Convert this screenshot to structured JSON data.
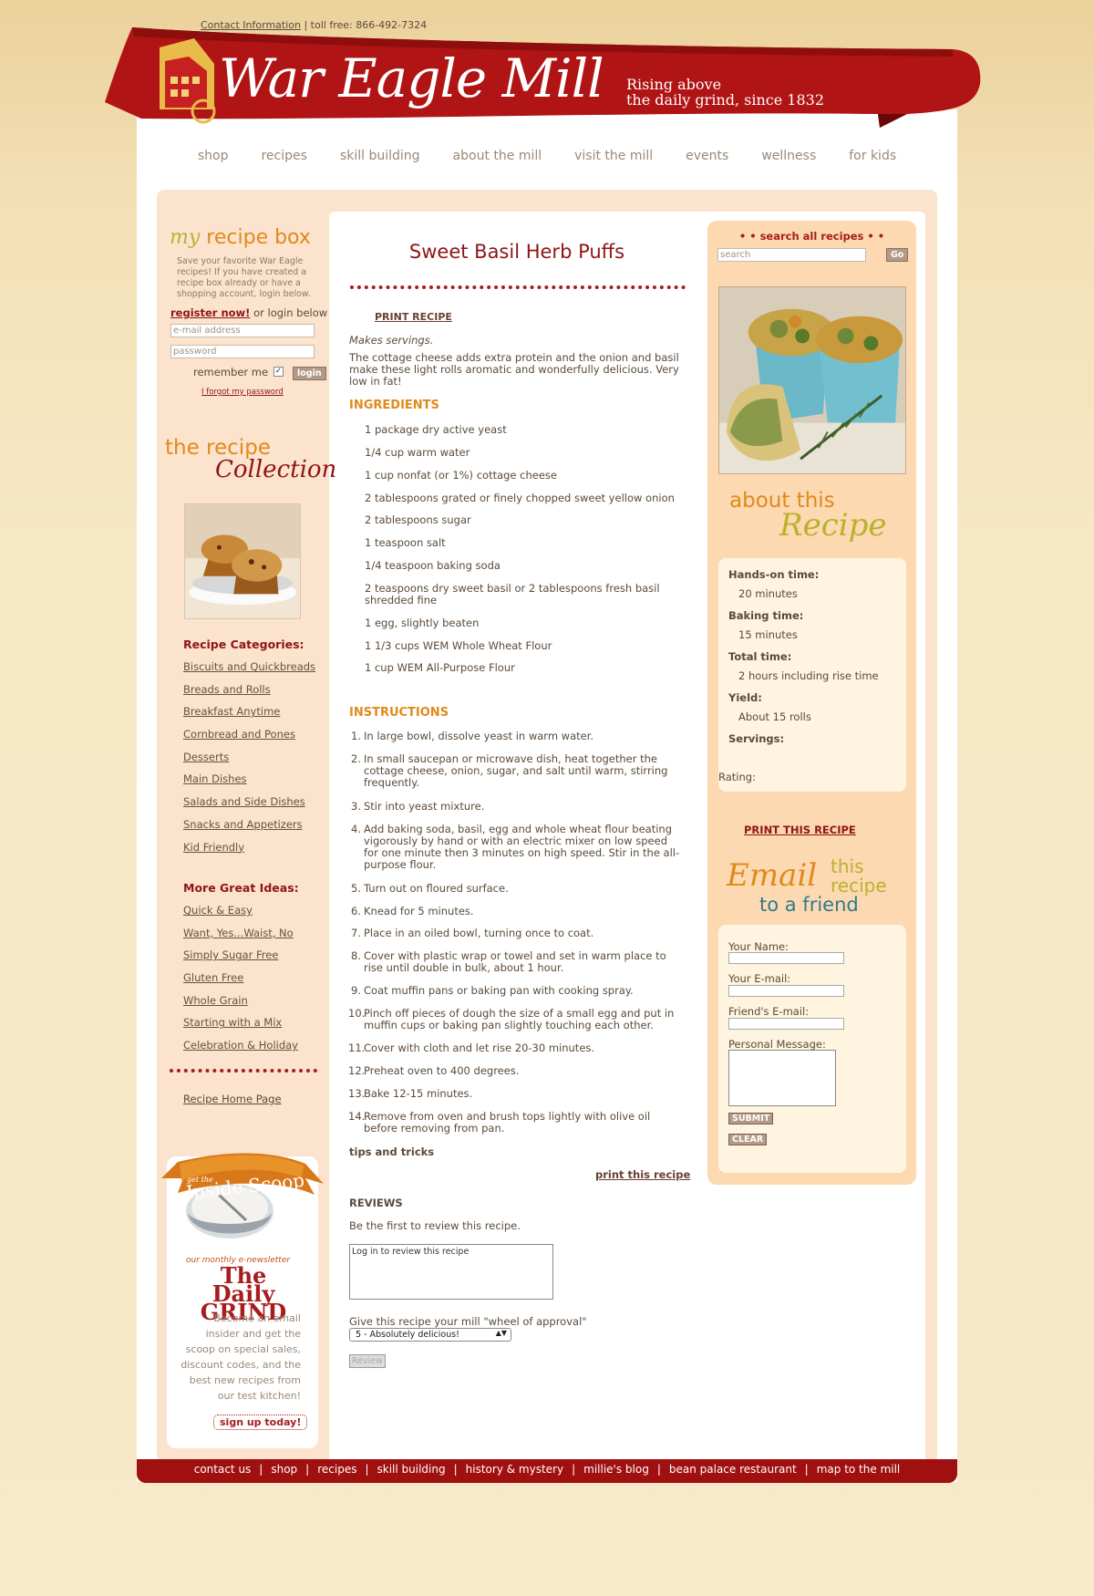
{
  "topbar": {
    "contact_label": "Contact Information",
    "tollfree": " | toll free: 866-492-7324"
  },
  "brand": {
    "logo": "War Eagle Mill",
    "tagline_line1": "Rising above",
    "tagline_line2": "the daily grind, since 1832"
  },
  "nav": [
    "shop",
    "recipes",
    "skill building",
    "about the mill",
    "visit the mill",
    "events",
    "wellness",
    "for kids"
  ],
  "recipe_box": {
    "title_my": "my",
    "title_rest": "recipe box",
    "description": "Save your favorite War Eagle recipes!  If you have created a recipe box already or have a shopping account, login below.",
    "register_label": "register now!",
    "register_suffix": " or login below",
    "email_placeholder": "e-mail address",
    "password_placeholder": "password",
    "remember_label": "remember me",
    "login_label": "login",
    "forgot_label": "I forgot my password"
  },
  "collection": {
    "line1": "the recipe",
    "line2": "Collection"
  },
  "categories": {
    "heading": "Recipe Categories:",
    "items": [
      "Biscuits and Quickbreads",
      "Breads and Rolls",
      "Breakfast Anytime",
      "Cornbread and Pones",
      "Desserts",
      "Main Dishes",
      "Salads and Side Dishes",
      "Snacks and Appetizers",
      "Kid Friendly"
    ]
  },
  "more_ideas": {
    "heading": "More Great Ideas:",
    "items": [
      "Quick & Easy",
      "Want, Yes...Waist, No",
      "Simply Sugar Free",
      "Gluten Free",
      "Whole Grain",
      "Starting with a Mix",
      "Celebration & Holiday"
    ]
  },
  "recipe_home": "Recipe Home Page",
  "newsletter": {
    "banner": "Inside Scoop",
    "banner_small": "get the",
    "kicker": "our monthly e-newsletter",
    "title": "The Daily GRIND",
    "text": "Become an email insider and get the scoop on special sales, discount codes, and the best new recipes from our test kitchen!",
    "signup": "sign up today!"
  },
  "recipe": {
    "title": "Sweet Basil Herb Puffs",
    "print_top": "PRINT RECIPE",
    "makes": "Makes servings.",
    "intro": "The cottage cheese adds extra protein and the onion and basil make these light rolls aromatic and wonderfully delicious. Very low in fat!",
    "ingredients_heading": "INGREDIENTS",
    "ingredients": [
      "1 package dry active yeast",
      "1/4 cup warm water",
      "1 cup nonfat (or 1%) cottage cheese",
      "2 tablespoons grated or finely chopped sweet yellow onion",
      "2 tablespoons sugar",
      "1 teaspoon salt",
      "1/4 teaspoon baking soda",
      "2 teaspoons dry sweet basil or 2 tablespoons fresh basil shredded fine",
      "1 egg, slightly beaten",
      "1 1/3 cups WEM Whole Wheat Flour",
      "1 cup WEM All-Purpose Flour"
    ],
    "instructions_heading": "INSTRUCTIONS",
    "instructions": [
      "In large bowl, dissolve yeast in warm water.",
      "In small saucepan or microwave dish, heat together the cottage cheese, onion, sugar, and salt until warm, stirring frequently.",
      "Stir into yeast mixture.",
      "Add baking soda, basil, egg and whole wheat flour beating vigorously by hand or with an electric mixer on low speed for one minute then 3 minutes on high speed. Stir in the all-purpose flour.",
      "Turn out on floured surface.",
      "Knead for 5 minutes.",
      "Place in an oiled bowl, turning once to coat.",
      "Cover with plastic wrap or towel and set in warm place to rise until double in bulk, about 1 hour.",
      "Coat muffin pans or baking pan with cooking spray.",
      "Pinch off pieces of dough the size of a small egg and put in muffin cups or baking pan slightly touching each other.",
      "Cover with cloth and let rise 20-30 minutes.",
      "Preheat oven to 400 degrees.",
      "Bake 12-15 minutes.",
      "Remove from oven and brush tops lightly with olive oil before removing from pan."
    ],
    "tips": "tips and tricks",
    "print_bottom": "print this recipe"
  },
  "reviews": {
    "heading": "REVIEWS",
    "first": "Be the first to review this recipe.",
    "textarea": "Log in to review this recipe",
    "wheel_label": "Give this recipe your mill \"wheel of approval\"",
    "selected": "5 - Absolutely delicious!",
    "button": "Review"
  },
  "search": {
    "heading": "• •  search all recipes  • •",
    "placeholder": "search",
    "go": "Go"
  },
  "about_recipe": {
    "line1": "about this",
    "line2": "Recipe",
    "hands_on_label": "Hands-on time:",
    "hands_on": "20 minutes",
    "baking_label": "Baking time:",
    "baking": "15 minutes",
    "total_label": "Total time:",
    "total": "2 hours including rise time",
    "yield_label": "Yield:",
    "yield": "About 15 rolls",
    "servings_label": "Servings:",
    "rating_label": "Rating:"
  },
  "print_this": "PRINT THIS RECIPE",
  "email_friend": {
    "word1": "Email",
    "word2": "this",
    "word3": "recipe",
    "word4": "to a friend",
    "name_label": "Your Name:",
    "email_label": "Your E-mail:",
    "friend_label": "Friend's E-mail:",
    "message_label": "Personal Message:",
    "submit": "SUBMIT",
    "clear": "CLEAR"
  },
  "footer": [
    "contact us",
    "shop",
    "recipes",
    "skill building",
    "history & mystery",
    "millie's blog",
    "bean palace restaurant",
    "map to the mill"
  ],
  "colors": {
    "brand_red": "#a01010",
    "accent_orange": "#e08a1c",
    "olive": "#b9b22c",
    "teal": "#2f7a8a"
  }
}
